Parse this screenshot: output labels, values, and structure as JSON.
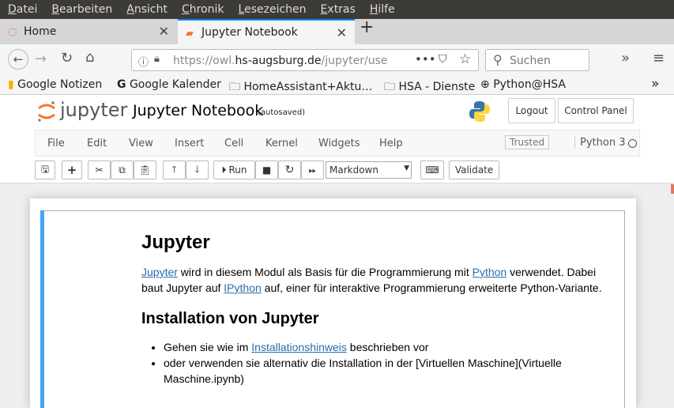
{
  "menubar": [
    "Datei",
    "Bearbeiten",
    "Ansicht",
    "Chronik",
    "Lesezeichen",
    "Extras",
    "Hilfe"
  ],
  "tabs": [
    {
      "label": "Home",
      "icon": "ubuntu-icon"
    },
    {
      "label": "Jupyter Notebook",
      "icon": "notebook-icon"
    }
  ],
  "url": {
    "prefix": "https://owl.",
    "domain": "hs-augsburg.de",
    "path": "/jupyter/use"
  },
  "search_placeholder": "Suchen",
  "bookmarks": [
    "Google Notizen",
    "Google Kalender",
    "HomeAssistant+Aktu…",
    "HSA - Dienste",
    "Python@HSA"
  ],
  "jupyter": {
    "logo": "jupyter",
    "title": "Jupyter Notebook",
    "saved": "(autosaved)",
    "logout": "Logout",
    "control_panel": "Control Panel",
    "menu": [
      "File",
      "Edit",
      "View",
      "Insert",
      "Cell",
      "Kernel",
      "Widgets",
      "Help"
    ],
    "trusted": "Trusted",
    "kernel": "Python 3",
    "run": "Run",
    "cell_type": "Markdown",
    "validate": "Validate"
  },
  "cell": {
    "h1": "Jupyter",
    "p1_link1": "Jupyter",
    "p1_t1": " wird in diesem Modul als Basis für die Programmierung mit ",
    "p1_link2": "Python",
    "p1_t2": " verwendet. Dabei baut Jupyter auf ",
    "p1_link3": "IPython",
    "p1_t3": " auf, einer für interaktive Programmierung erweiterte Python-Variante.",
    "h2": "Installation von Jupyter",
    "li1_t1": "Gehen sie wie im ",
    "li1_link": "Installationshinweis",
    "li1_t2": " beschrieben vor",
    "li2": "oder verwenden sie alternativ die Installation in der [Virtuellen Maschine](Virtuelle Maschine.ipynb)"
  },
  "colors": {
    "accent": "#0a84ff",
    "cell_selected": "#42a5f5",
    "link": "#296eaa"
  }
}
